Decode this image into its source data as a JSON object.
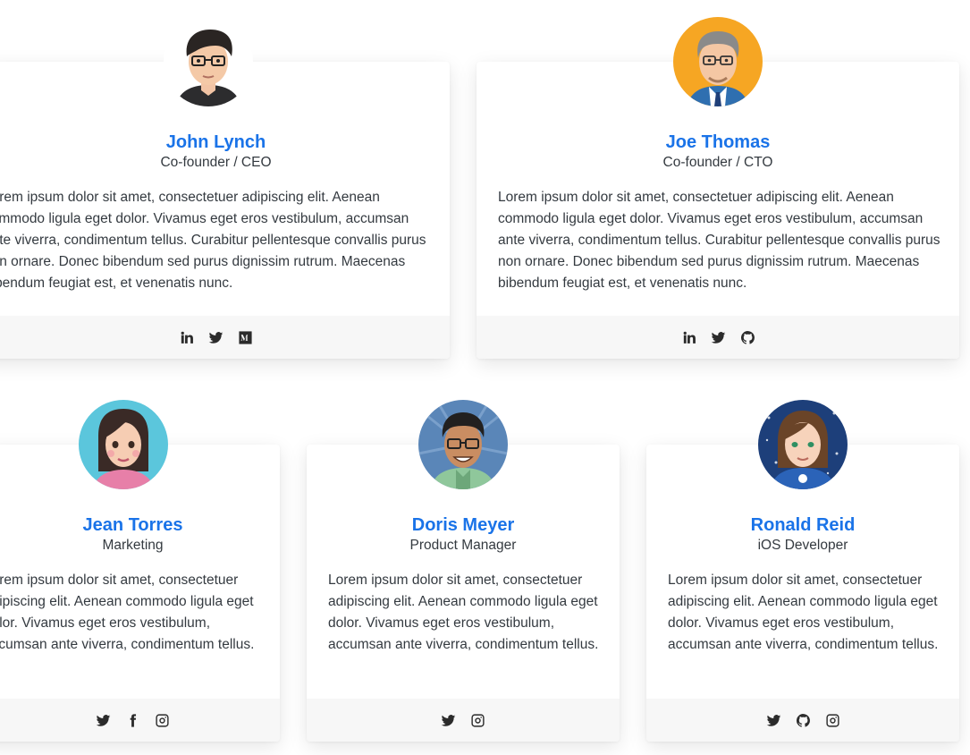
{
  "team": [
    {
      "name": "John Lynch",
      "role": "Co-founder / CEO",
      "bio": "Lorem ipsum dolor sit amet, consectetuer adipiscing elit. Aenean commodo ligula eget dolor. Vivamus eget eros vestibulum, accumsan ante viverra, condimentum tellus. Curabitur pellentesque convallis purus non ornare. Donec bibendum sed purus dignissim rutrum. Maecenas bibendum feugiat est, et venenatis nunc.",
      "socials": [
        "linkedin-icon",
        "twitter-icon",
        "medium-icon"
      ]
    },
    {
      "name": "Joe Thomas",
      "role": "Co-founder / CTO",
      "bio": "Lorem ipsum dolor sit amet, consectetuer adipiscing elit. Aenean commodo ligula eget dolor. Vivamus eget eros vestibulum, accumsan ante viverra, condimentum tellus. Curabitur pellentesque convallis purus non ornare. Donec bibendum sed purus dignissim rutrum. Maecenas bibendum feugiat est, et venenatis nunc.",
      "socials": [
        "linkedin-icon",
        "twitter-icon",
        "github-icon"
      ]
    },
    {
      "name": "Jean Torres",
      "role": "Marketing",
      "bio": "Lorem ipsum dolor sit amet, consectetuer adipiscing elit. Aenean commodo ligula eget dolor. Vivamus eget eros vestibulum, accumsan ante viverra, condimentum tellus.",
      "socials": [
        "twitter-icon",
        "facebook-icon",
        "instagram-icon"
      ]
    },
    {
      "name": "Doris Meyer",
      "role": "Product Manager",
      "bio": "Lorem ipsum dolor sit amet, consectetuer adipiscing elit. Aenean commodo ligula eget dolor. Vivamus eget eros vestibulum, accumsan ante viverra, condimentum tellus.",
      "socials": [
        "twitter-icon",
        "instagram-icon"
      ]
    },
    {
      "name": "Ronald Reid",
      "role": "iOS Developer",
      "bio": "Lorem ipsum dolor sit amet, consectetuer adipiscing elit. Aenean commodo ligula eget dolor. Vivamus eget eros vestibulum, accumsan ante viverra, condimentum tellus.",
      "socials": [
        "twitter-icon",
        "github-icon",
        "instagram-icon"
      ]
    }
  ],
  "colors": {
    "name": "#1a73e8",
    "footer": "#f7f7f7",
    "icon": "#2b2b2b"
  }
}
